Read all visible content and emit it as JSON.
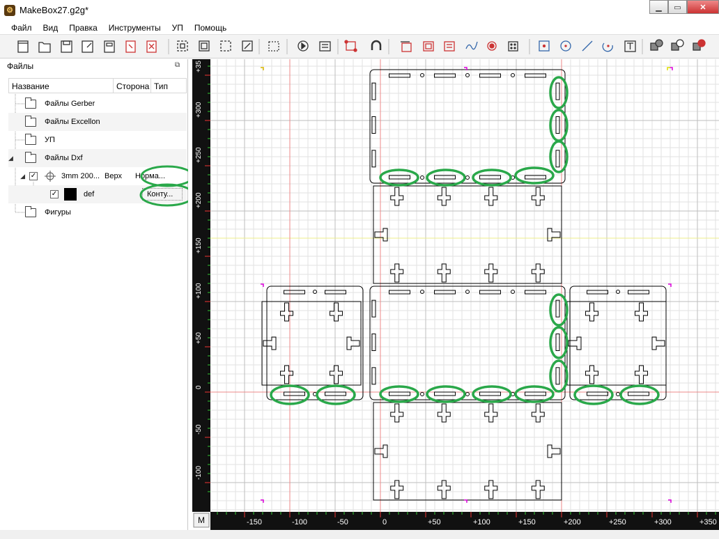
{
  "window": {
    "title": "MakeBox27.g2g*"
  },
  "menu": [
    "Файл",
    "Вид",
    "Правка",
    "Инструменты",
    "УП",
    "Помощь"
  ],
  "panel": {
    "title": "Файлы",
    "columns": [
      "Название",
      "Сторона",
      "Тип"
    ],
    "rows": [
      {
        "label": "Файлы Gerber"
      },
      {
        "label": "Файлы Excellon"
      },
      {
        "label": "УП"
      },
      {
        "label": "Файлы Dxf"
      },
      {
        "label": "3mm 200...",
        "side": "Верх",
        "type": "Норма..."
      },
      {
        "label": "def",
        "type": "Конту..."
      },
      {
        "label": "Фигуры"
      }
    ]
  },
  "ruler": {
    "x_ticks": [
      "-150",
      "-100",
      "-50",
      "0",
      "+50",
      "+100",
      "+150",
      "+200",
      "+250",
      "+300",
      "+350"
    ],
    "y_ticks": [
      "+35",
      "+300",
      "+250",
      "+200",
      "+150",
      "+100",
      "+50",
      "0",
      "-50",
      "-100"
    ],
    "corner_label": "M"
  },
  "colors": {
    "highlight": "#2aa84a",
    "ruler_bg": "#111111",
    "grid_major": "#bdbdbd",
    "grid_minor": "#e2e2e2"
  }
}
